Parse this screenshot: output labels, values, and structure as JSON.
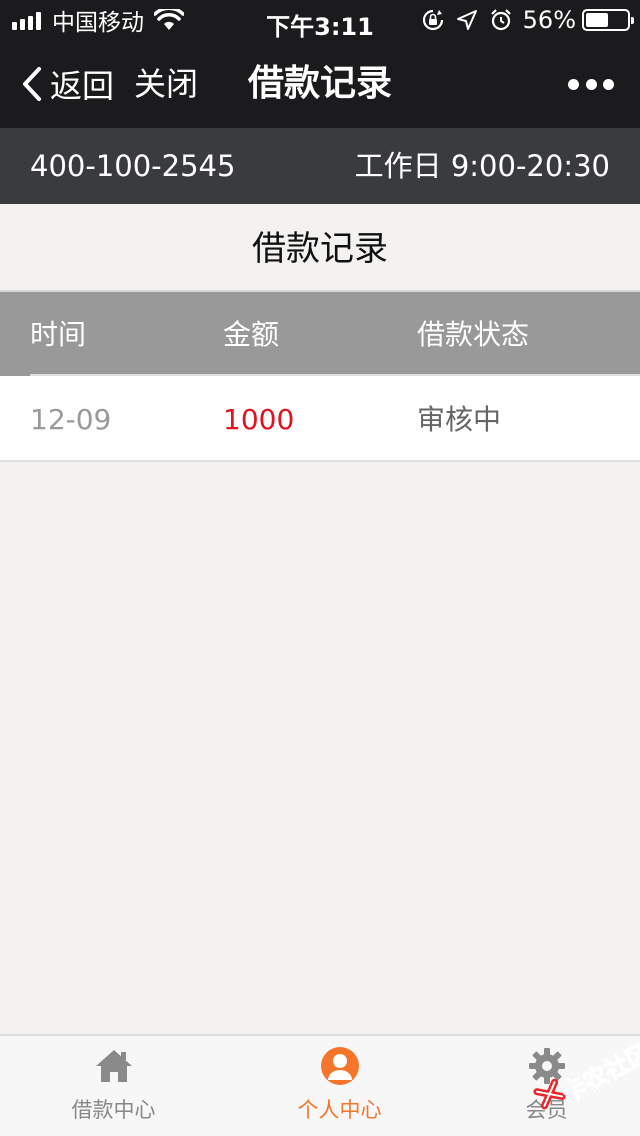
{
  "status_bar": {
    "carrier": "中国移动",
    "time": "下午3:11",
    "battery": "56%",
    "battery_level": 0.56
  },
  "nav": {
    "back_label": "返回",
    "close_label": "关闭",
    "title": "借款记录"
  },
  "hotline": {
    "phone": "400-100-2545",
    "hours": "工作日 9:00-20:30"
  },
  "section_title": "借款记录",
  "table": {
    "columns": [
      "时间",
      "金额",
      "借款状态"
    ],
    "rows": [
      {
        "time": "12-09",
        "amount": "1000",
        "status": "审核中"
      }
    ]
  },
  "tabs": [
    {
      "label": "借款中心",
      "icon": "home-icon",
      "active": false
    },
    {
      "label": "个人中心",
      "icon": "user-icon",
      "active": true
    },
    {
      "label": "会员",
      "icon": "gear-icon",
      "active": false
    }
  ],
  "watermark": {
    "text": "卡农社区"
  },
  "colors": {
    "nav_bg": "#1b1b1d",
    "hotline_bg": "#3a3b3f",
    "table_header_bg": "#999999",
    "amount_red": "#e0141e",
    "active_orange": "#f5762a"
  }
}
